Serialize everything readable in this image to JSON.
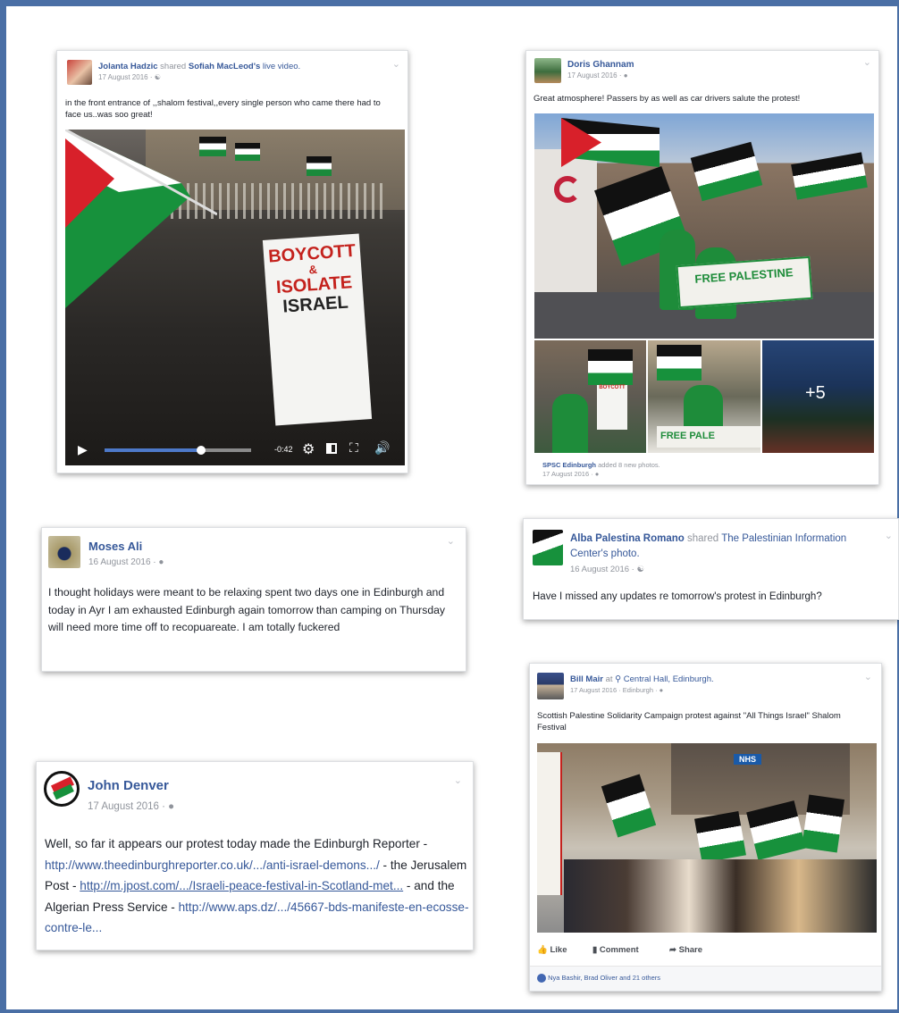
{
  "colors": {
    "frame_border": "#4a6fa5",
    "fb_link": "#365899",
    "meta_gray": "#90949c",
    "flag_red": "#d8202a",
    "flag_green": "#16883a",
    "tshirt_green": "#1e8c3a"
  },
  "post_jolanta": {
    "author": "Jolanta Hadzic",
    "shared_word": "shared",
    "shared_source": "Sofiah MacLeod's",
    "shared_type": "live video.",
    "date": "17 August 2016 · ",
    "privacy_icon": "friends-icon",
    "text": "in the front entrance of ,,shalom festival,,every single person who came there had to face us..was soo great!",
    "sign_lines": [
      "BOYCOTT",
      "&",
      "ISOLATE",
      "ISRAEL"
    ],
    "video": {
      "time": "-0:42",
      "progress": 0.66
    }
  },
  "post_doris": {
    "author": "Doris Ghannam",
    "date": "17 August 2016 · ",
    "privacy_icon": "globe-icon",
    "text": "Great atmosphere! Passers by as well as car drivers salute the protest!",
    "more_photos": "+5",
    "banner_text": "FREE PALESTINE",
    "footer_author": "SPSC Edinburgh",
    "footer_action": "added 8 new photos.",
    "footer_date": "17 August 2016 · "
  },
  "post_moses": {
    "author": "Moses Ali",
    "date": "16 August 2016 · ",
    "privacy_icon": "globe-icon",
    "text": "I thought holidays were meant to be relaxing spent two days one in Edinburgh and today in Ayr I am exhausted Edinburgh again tomorrow than camping on Thursday will need more time off to recopuareate. I am totally fuckered"
  },
  "post_alba": {
    "author": "Alba Palestina Romano",
    "shared_word": "shared",
    "shared_source": "The Palestinian Information Center's",
    "shared_type": "photo.",
    "date": "16 August 2016 · ",
    "privacy_icon": "friends-icon",
    "text": "Have I missed any updates re tomorrow's protest in Edinburgh?"
  },
  "post_john": {
    "author": "John Denver",
    "date": "17 August 2016 · ",
    "privacy_icon": "globe-icon",
    "text_1": "Well, so far it appears our protest today made the Edinburgh Reporter - ",
    "link_1": "http://www.theedinburghreporter.co.uk/.../anti-israel-demons.../",
    "text_2": " - the Jerusalem Post - ",
    "link_2": "http://m.jpost.com/.../Israeli-peace-festival-in-Scotland-met...",
    "text_3": " - and the Algerian Press Service - ",
    "link_3": "http://www.aps.dz/.../45667-bds-manifeste-en-ecosse-contre-le..."
  },
  "post_bill": {
    "author": "Bill Mair",
    "at_word": "at",
    "location_icon": "map-pin-icon",
    "location": "Central Hall, Edinburgh.",
    "date": "17 August 2016 · Edinburgh · ",
    "privacy_icon": "globe-icon",
    "text": "Scottish Palestine Solidarity Campaign protest against \"All Things Israel\" Shalom Festival",
    "shop_sign": "NHS",
    "actions": {
      "like": "Like",
      "comment": "Comment",
      "share": "Share"
    },
    "reactions": "Nya Bashir, Brad Oliver and 21 others"
  }
}
